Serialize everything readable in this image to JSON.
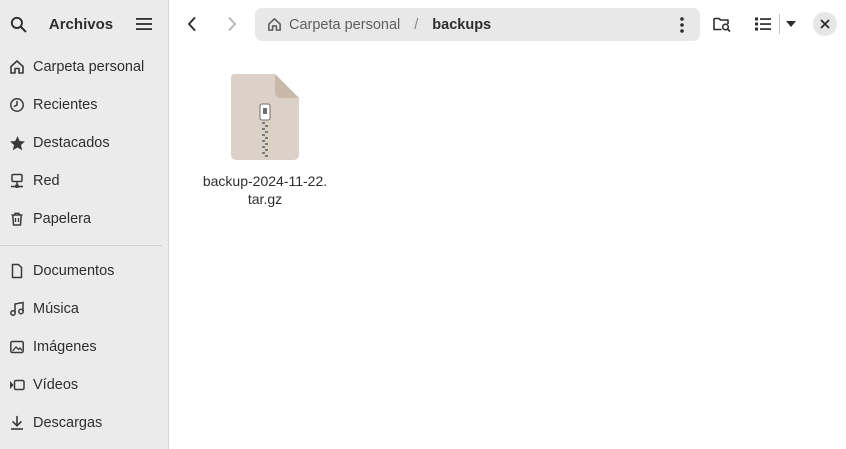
{
  "sidebar": {
    "title": "Archivos",
    "places": [
      {
        "label": "Carpeta personal",
        "icon": "home-icon"
      },
      {
        "label": "Recientes",
        "icon": "clock-icon"
      },
      {
        "label": "Destacados",
        "icon": "star-icon"
      },
      {
        "label": "Red",
        "icon": "network-icon"
      },
      {
        "label": "Papelera",
        "icon": "trash-icon"
      }
    ],
    "bookmarks": [
      {
        "label": "Documentos",
        "icon": "document-icon"
      },
      {
        "label": "Música",
        "icon": "music-icon"
      },
      {
        "label": "Imágenes",
        "icon": "image-icon"
      },
      {
        "label": "Vídeos",
        "icon": "video-icon"
      },
      {
        "label": "Descargas",
        "icon": "download-icon"
      }
    ]
  },
  "pathbar": {
    "home_label": "Carpeta personal",
    "separator": "/",
    "current": "backups"
  },
  "files": [
    {
      "name": "backup-2024-11-22.\ntar.gz",
      "icon": "archive-icon"
    }
  ]
}
